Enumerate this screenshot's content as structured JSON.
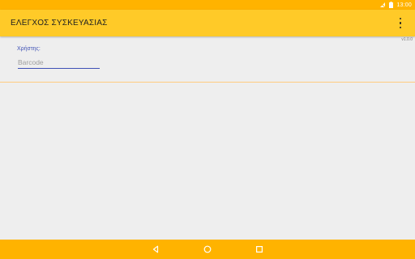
{
  "status_bar": {
    "time": "13:00",
    "icons": [
      "signal-off-icon",
      "battery-icon"
    ]
  },
  "app_bar": {
    "title": "ΕΛΕΓΧΟΣ ΣΥΣΚΕΥΑΣΙΑΣ",
    "menu_icon": "more-vert-icon"
  },
  "version": "v1.0.0",
  "form": {
    "user_label": "Χρήστης:",
    "barcode_value": "",
    "barcode_placeholder": "Barcode"
  },
  "nav_bar": {
    "buttons": [
      "back-icon",
      "home-icon",
      "recents-icon"
    ]
  },
  "colors": {
    "status_bar": "#ffb300",
    "app_bar": "#ffca28",
    "accent": "#3f51b5",
    "background": "#eeeeee",
    "divider": "#ffcc80",
    "nav_bar": "#ffb300"
  }
}
